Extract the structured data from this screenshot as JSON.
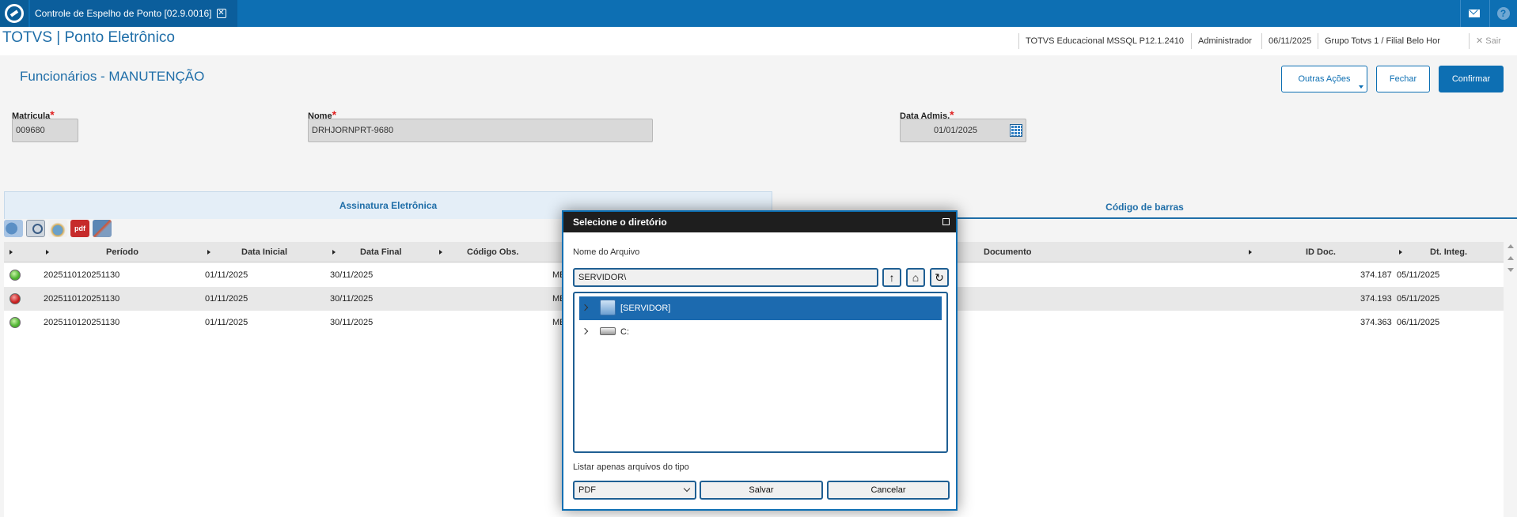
{
  "topbar": {
    "tab_title": "Controle de Espelho de Ponto [02.9.0016]",
    "tab_close": "✕",
    "help_label": "?"
  },
  "header": {
    "app_title": "TOTVS | Ponto Eletrônico",
    "environment": "TOTVS Educacional MSSQL P12.1.2410",
    "user": "Administrador",
    "date": "06/11/2025",
    "branch": "Grupo Totvs 1 / Filial Belo Hor",
    "exit_label": "✕  Sair"
  },
  "form": {
    "title": "Funcionários - MANUTENÇÃO",
    "actions": {
      "other_label": "Outras Ações",
      "close_label": "Fechar",
      "confirm_label": "Confirmar"
    },
    "fields": {
      "matricula_label": "Matricula",
      "matricula_value": "009680",
      "nome_label": "Nome",
      "nome_value": "DRHJORNPRT-9680",
      "data_admis_label": "Data Admis.",
      "data_admis_value": "01/01/2025",
      "required_mark": "*"
    }
  },
  "tabs": {
    "assinatura": "Assinatura Eletrônica",
    "codigo_barras": "Código de barras"
  },
  "toolbar": {
    "pdf_label": "pdf"
  },
  "grid": {
    "columns": {
      "periodo": "Período",
      "data_inicial": "Data Inicial",
      "data_final": "Data Final",
      "codigo_obs": "Código Obs.",
      "documento": "Documento",
      "id_doc": "ID Doc.",
      "dt_integ": "Dt. Integ."
    },
    "rows": [
      {
        "status": "green",
        "periodo": "2025110120251130",
        "data_inicial": "01/11/2025",
        "data_final": "30/11/2025",
        "codigo_obs": "ME",
        "id_doc": "374.187",
        "dt_integ": "05/11/2025"
      },
      {
        "status": "red",
        "periodo": "2025110120251130",
        "data_inicial": "01/11/2025",
        "data_final": "30/11/2025",
        "codigo_obs": "ME",
        "id_doc": "374.193",
        "dt_integ": "05/11/2025"
      },
      {
        "status": "green",
        "periodo": "2025110120251130",
        "data_inicial": "01/11/2025",
        "data_final": "30/11/2025",
        "codigo_obs": "ME",
        "id_doc": "374.363",
        "dt_integ": "06/11/2025"
      }
    ]
  },
  "dialog": {
    "title": "Selecione o diretório",
    "file_name_label": "Nome do Arquivo",
    "path_value": "SERVIDOR\\",
    "tree": [
      {
        "label": "[SERVIDOR]",
        "selected": true
      },
      {
        "label": "C:",
        "selected": false
      }
    ],
    "filter_label": "Listar apenas arquivos do tipo",
    "filter_value": "PDF",
    "save_label": "Salvar",
    "cancel_label": "Cancelar"
  },
  "colors": {
    "brand": "#0d6fb3",
    "status_green": "#4cb22f",
    "status_red": "#c81f1f"
  }
}
